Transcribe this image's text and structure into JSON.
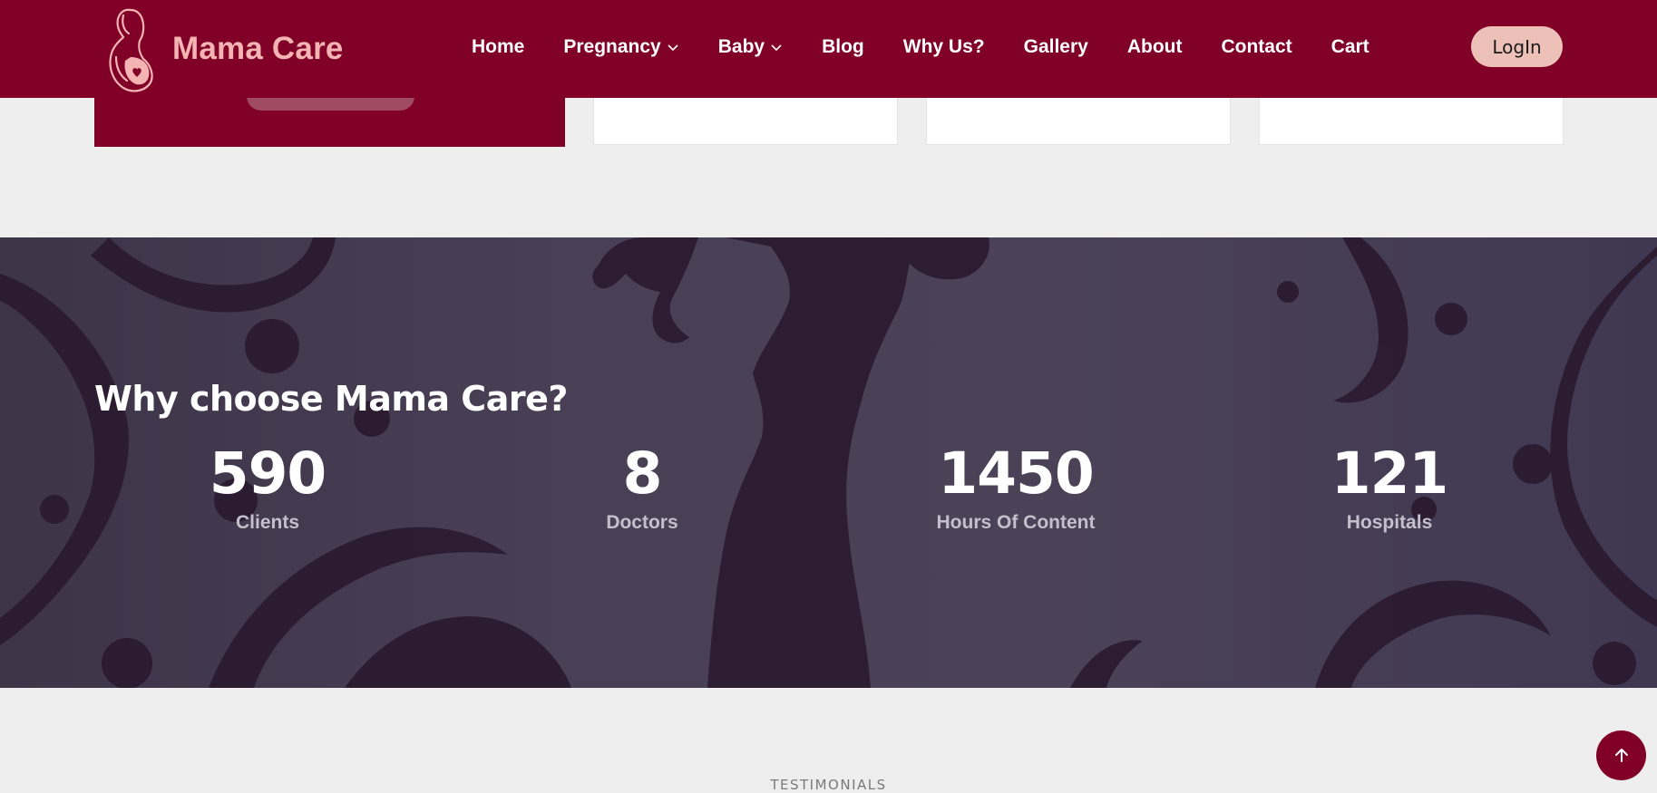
{
  "brand": {
    "name": "Mama Care",
    "logo_icon": "pregnant-woman-icon"
  },
  "nav": {
    "items": [
      {
        "label": "Home",
        "has_dropdown": false
      },
      {
        "label": "Pregnancy",
        "has_dropdown": true
      },
      {
        "label": "Baby",
        "has_dropdown": true
      },
      {
        "label": "Blog",
        "has_dropdown": false
      },
      {
        "label": "Why Us?",
        "has_dropdown": false
      },
      {
        "label": "Gallery",
        "has_dropdown": false
      },
      {
        "label": "About",
        "has_dropdown": false
      },
      {
        "label": "Contact",
        "has_dropdown": false
      },
      {
        "label": "Cart",
        "has_dropdown": false
      }
    ],
    "login_label": "LogIn"
  },
  "why": {
    "title": "Why choose Mama Care?",
    "stats": [
      {
        "value": "590",
        "label": "Clients"
      },
      {
        "value": "8",
        "label": "Doctors"
      },
      {
        "value": "1450",
        "label": "Hours Of Content"
      },
      {
        "value": "121",
        "label": "Hospitals"
      }
    ]
  },
  "testimonials": {
    "eyebrow": "TESTIMONIALS"
  },
  "scroll_top": {
    "icon": "arrow-up-icon"
  },
  "colors": {
    "brand": "#800028",
    "logo_text": "#f4b4b3",
    "login_bg": "#edc0b8",
    "section_bg": "#eeeeee",
    "why_bg": "#4a4056"
  }
}
